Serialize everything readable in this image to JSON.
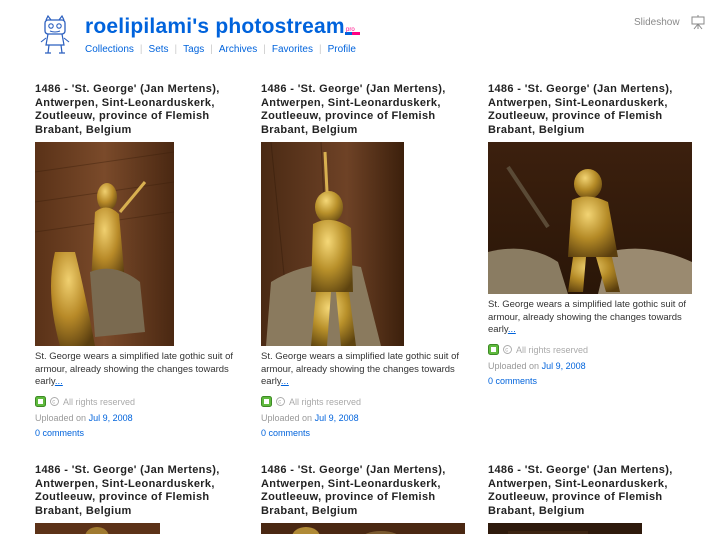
{
  "header": {
    "title": "roelipilami's photostream",
    "nav": [
      "Collections",
      "Sets",
      "Tags",
      "Archives",
      "Favorites",
      "Profile"
    ],
    "slideshow_label": "Slideshow"
  },
  "photos": [
    {
      "title": "1486 - 'St. George' (Jan Mertens), Antwerpen, Sint-Leonarduskerk, Zoutleeuw, province of Flemish Brabant, Belgium",
      "description": "St. George wears a simplified late gothic suit of armour, already showing the changes towards early",
      "more": "...",
      "rights": "All rights reserved",
      "uploaded_label": "Uploaded on",
      "date": "Jul 9, 2008",
      "comments": "0 comments"
    },
    {
      "title": "1486 - 'St. George' (Jan Mertens), Antwerpen, Sint-Leonarduskerk, Zoutleeuw, province of Flemish Brabant, Belgium",
      "description": "St. George wears a simplified late gothic suit of armour, already showing the changes towards early",
      "more": "...",
      "rights": "All rights reserved",
      "uploaded_label": "Uploaded on",
      "date": "Jul 9, 2008",
      "comments": "0 comments"
    },
    {
      "title": "1486 - 'St. George' (Jan Mertens), Antwerpen, Sint-Leonarduskerk, Zoutleeuw, province of Flemish Brabant, Belgium",
      "description": "St. George wears a simplified late gothic suit of armour, already showing the changes towards early",
      "more": "...",
      "rights": "All rights reserved",
      "uploaded_label": "Uploaded on",
      "date": "Jul 9, 2008",
      "comments": "0 comments"
    },
    {
      "title": "1486 - 'St. George' (Jan Mertens), Antwerpen, Sint-Leonarduskerk, Zoutleeuw, province of Flemish Brabant, Belgium"
    },
    {
      "title": "1486 - 'St. George' (Jan Mertens), Antwerpen, Sint-Leonarduskerk, Zoutleeuw, province of Flemish Brabant, Belgium"
    },
    {
      "title": "1486 - 'St. George' (Jan Mertens), Antwerpen, Sint-Leonarduskerk, Zoutleeuw, province of Flemish Brabant, Belgium"
    }
  ],
  "colors": {
    "link": "#0063dc",
    "title_text": "#222222",
    "muted": "#999999"
  },
  "icons": [
    "buddy-icon",
    "pro-badge-icon",
    "slideshow-icon",
    "tag-icon",
    "rights-icon"
  ]
}
